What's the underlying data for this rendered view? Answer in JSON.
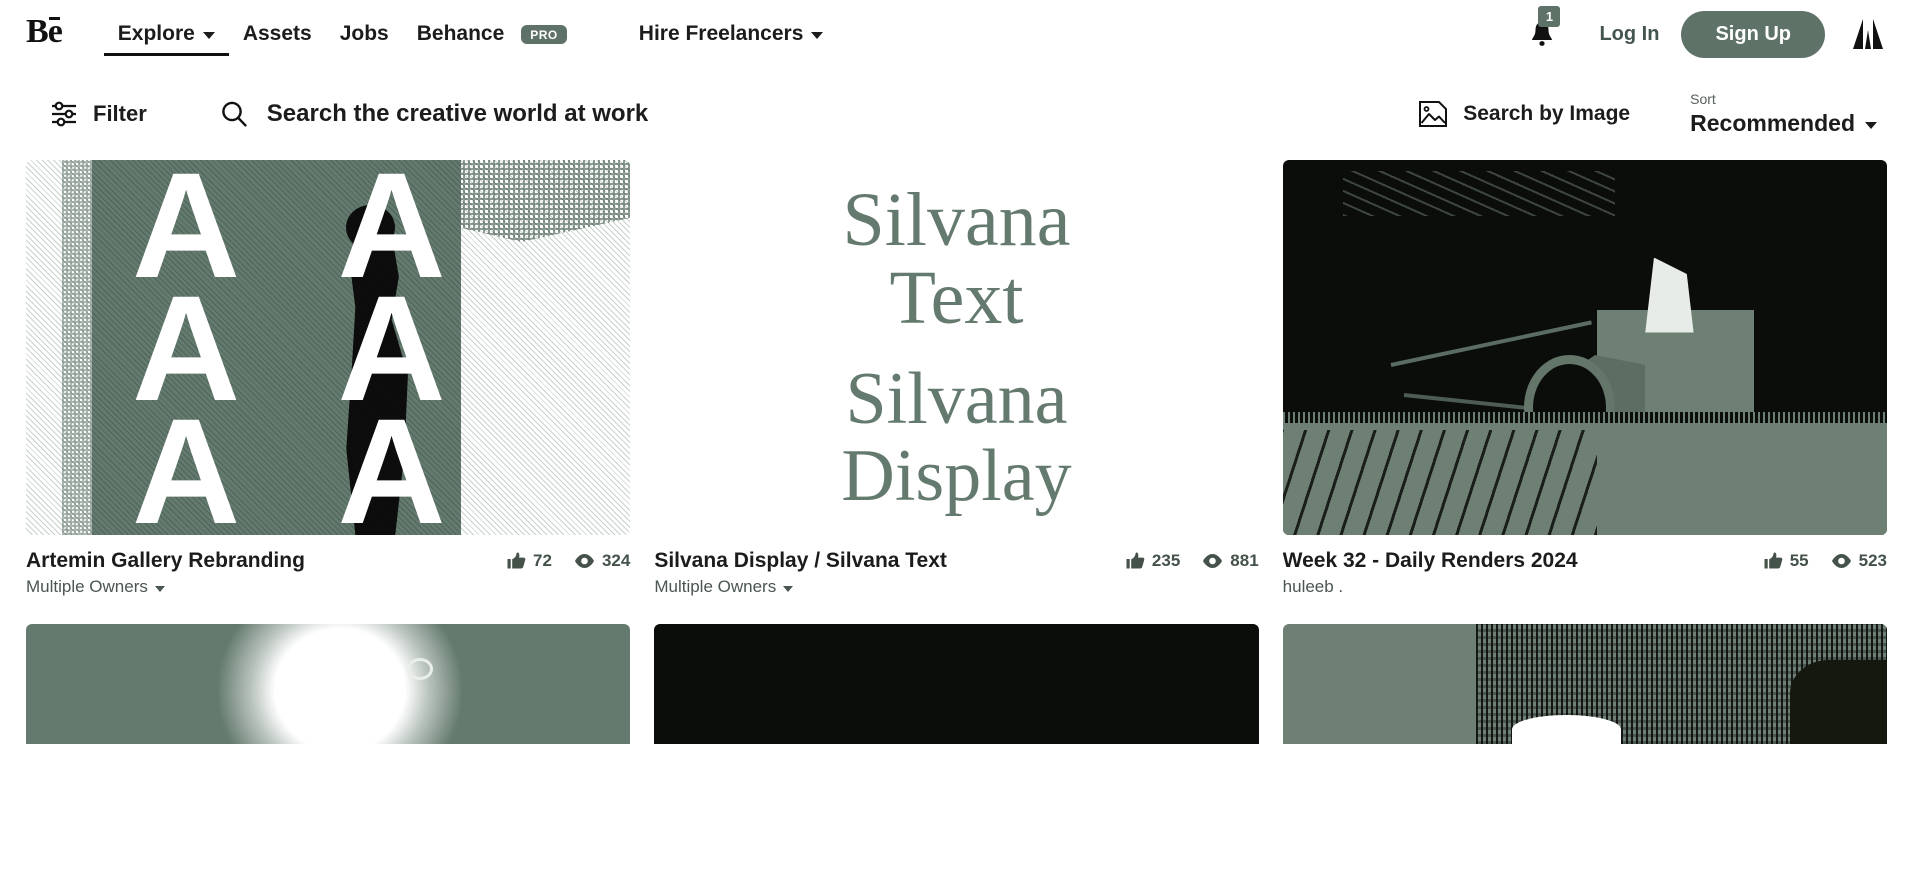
{
  "brand": {
    "logo": "Bē",
    "adobe_mark": "adobe-icon"
  },
  "nav": {
    "items": [
      {
        "label": "Explore",
        "has_caret": true,
        "active": true,
        "badge": null
      },
      {
        "label": "Assets",
        "has_caret": false,
        "active": false,
        "badge": null
      },
      {
        "label": "Jobs",
        "has_caret": false,
        "active": false,
        "badge": null
      },
      {
        "label": "Behance",
        "has_caret": false,
        "active": false,
        "badge": "PRO"
      },
      {
        "label": "Hire Freelancers",
        "has_caret": true,
        "active": false,
        "badge": null
      }
    ]
  },
  "account": {
    "notification_count": "1",
    "login_label": "Log In",
    "signup_label": "Sign Up"
  },
  "toolbar": {
    "filter_label": "Filter",
    "search_placeholder": "Search the creative world at work",
    "search_value": "",
    "search_by_image_label": "Search by Image",
    "sort_label": "Sort",
    "sort_value": "Recommended"
  },
  "colors": {
    "accent": "#5f7267",
    "art_sage": "#647a6e",
    "art_dark": "#0b0d0b",
    "text": "#1c1c1c",
    "muted": "#4a564f"
  },
  "projects": [
    {
      "title": "Artemin Gallery Rebranding",
      "owner": "Multiple Owners",
      "owner_has_caret": true,
      "likes": "72",
      "views": "324",
      "art": "dithered-letter-grid"
    },
    {
      "title": "Silvana Display / Silvana Text",
      "owner": "Multiple Owners",
      "owner_has_caret": true,
      "likes": "235",
      "views": "881",
      "art": "type-specimen",
      "specimen_lines": [
        "Silvana",
        "Text",
        "Silvana",
        "Display"
      ]
    },
    {
      "title": "Week 32 - Daily Renders 2024",
      "owner": "huleeb .",
      "owner_has_caret": false,
      "likes": "55",
      "views": "523",
      "art": "night-tractor"
    }
  ],
  "next_row": [
    {
      "art": "sage-glow"
    },
    {
      "art": "black-plate"
    },
    {
      "art": "sage-landscape"
    }
  ]
}
